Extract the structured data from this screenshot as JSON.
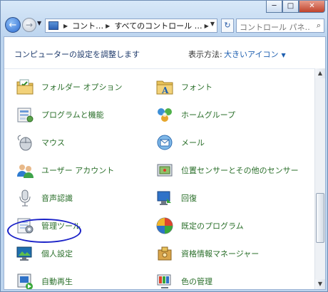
{
  "window": {
    "min_symbol": "─",
    "max_symbol": "□",
    "close_symbol": "✕"
  },
  "nav": {
    "back_symbol": "←",
    "forward_symbol": "→",
    "dropdown_symbol": "▼"
  },
  "address": {
    "crumbs": [
      "コント…",
      "すべてのコントロール …"
    ],
    "separator": "▶",
    "dropdown_symbol": "▼"
  },
  "refresh_symbol": "↻",
  "search": {
    "placeholder": "コントロール パネ…",
    "icon_symbol": "⌕"
  },
  "header": {
    "title": "コンピューターの設定を調整します",
    "view_label": "表示方法:",
    "view_value": "大きいアイコン",
    "view_arrow": "▼"
  },
  "items": [
    {
      "label": "フォルダー オプション",
      "icon": "folder-options-icon"
    },
    {
      "label": "フォント",
      "icon": "fonts-folder-icon"
    },
    {
      "label": "プログラムと機能",
      "icon": "programs-features-icon"
    },
    {
      "label": "ホームグループ",
      "icon": "homegroup-icon"
    },
    {
      "label": "マウス",
      "icon": "mouse-icon"
    },
    {
      "label": "メール",
      "icon": "mail-icon"
    },
    {
      "label": "ユーザー アカウント",
      "icon": "user-accounts-icon"
    },
    {
      "label": "位置センサーとその他のセンサー",
      "icon": "sensors-icon"
    },
    {
      "label": "音声認識",
      "icon": "microphone-icon"
    },
    {
      "label": "回復",
      "icon": "recovery-icon"
    },
    {
      "label": "管理ツール",
      "icon": "admin-tools-icon"
    },
    {
      "label": "既定のプログラム",
      "icon": "default-programs-icon"
    },
    {
      "label": "個人設定",
      "icon": "personalization-icon"
    },
    {
      "label": "資格情報マネージャー",
      "icon": "credential-manager-icon"
    },
    {
      "label": "自動再生",
      "icon": "autoplay-icon"
    },
    {
      "label": "色の管理",
      "icon": "color-management-icon"
    }
  ],
  "highlight": {
    "item": "音声認識",
    "color": "#1c23c8"
  },
  "scrollbar": {
    "up_symbol": "▲",
    "down_symbol": "▼"
  },
  "colors": {
    "link_text": "#2a6f2a",
    "title_text": "#1e3a6b",
    "accent": "#1e5fb0"
  }
}
